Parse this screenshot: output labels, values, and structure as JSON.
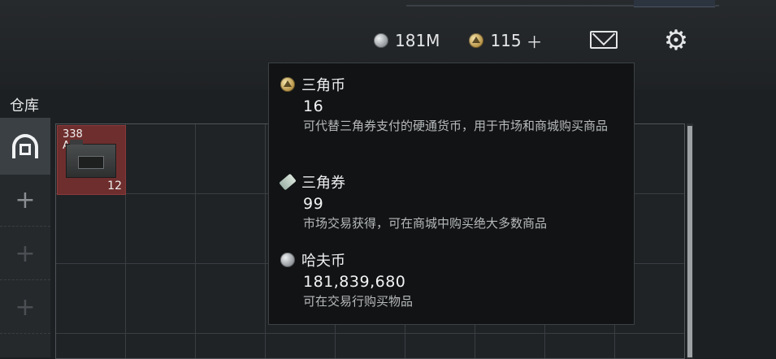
{
  "currencies": {
    "haf_amount": "181M",
    "triangle_coin_amount": "115",
    "add_symbol": "＋"
  },
  "warehouse": {
    "title": "仓库",
    "add_symbol": "+",
    "item": {
      "name": "338\nAP",
      "count": "12"
    }
  },
  "tooltip": {
    "sections": [
      {
        "name": "三角币",
        "value": "16",
        "desc": "可代替三角券支付的硬通货币，用于市场和商城购买商品",
        "icon": "gold-coin-icon"
      },
      {
        "name": "三角券",
        "value": "99",
        "desc": "市场交易获得，可在商城中购买绝大多数商品",
        "icon": "ticket-icon"
      },
      {
        "name": "哈夫币",
        "value": "181,839,680",
        "desc": "可在交易行购买物品",
        "icon": "silver-coin-icon"
      }
    ]
  },
  "icons": {
    "mail": "mail-icon",
    "settings": "gear-icon",
    "warehouse_tab": "warehouse-icon"
  },
  "colors": {
    "background": "#1d2022",
    "tooltip_bg": "#111314",
    "item_bg": "#6e2e2e",
    "text": "#d8dadb"
  }
}
